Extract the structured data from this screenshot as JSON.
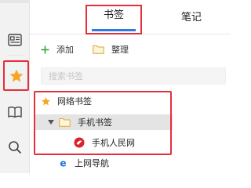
{
  "rail": {
    "icons": [
      "card-icon",
      "star-icon",
      "book-icon",
      "search-icon"
    ]
  },
  "tabs": [
    {
      "label": "书签",
      "active": true
    },
    {
      "label": "笔记",
      "active": false
    }
  ],
  "toolbar": {
    "add_label": "添加",
    "organize_label": "整理"
  },
  "search": {
    "placeholder": "搜索书签"
  },
  "tree": {
    "root": {
      "label": "网络书签",
      "icon": "star-icon"
    },
    "folder": {
      "label": "手机书签",
      "icon": "folder-icon",
      "expanded": true
    },
    "items": [
      {
        "label": "手机人民网",
        "icon": "people-daily-icon"
      }
    ],
    "next": {
      "label": "上网导航",
      "icon": "ie-icon"
    }
  },
  "colors": {
    "accent_blue": "#2f79e8",
    "highlight_red": "#e5303a",
    "star_orange": "#f5a623",
    "add_green": "#3aa636",
    "folder_yellow": "#f4c54a"
  }
}
